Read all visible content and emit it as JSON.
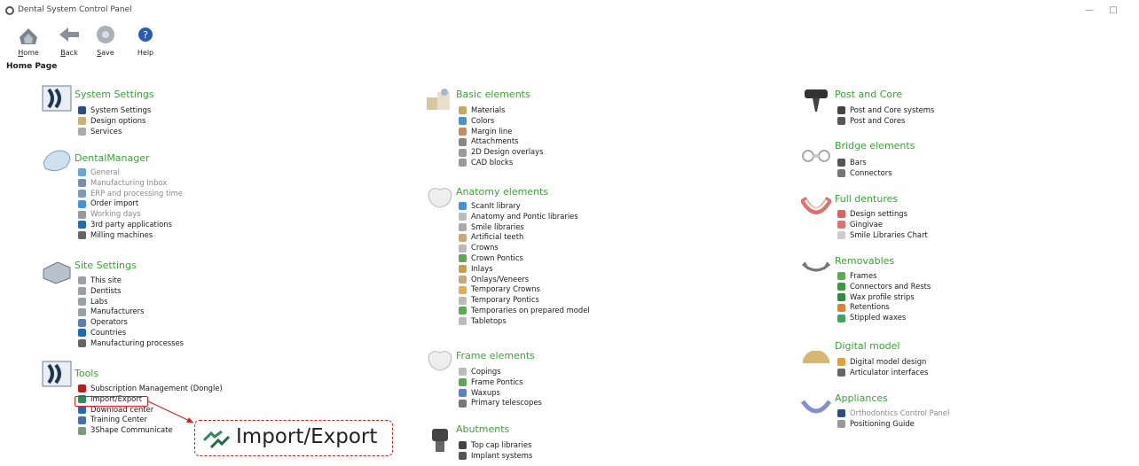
{
  "window": {
    "title": "Dental System Control Panel",
    "minimize": "—",
    "maximize": "□"
  },
  "toolbar": [
    {
      "key": "home",
      "label": "Home",
      "ul": "H",
      "rest": "ome",
      "icon": "home-icon"
    },
    {
      "key": "back",
      "label": "Back",
      "ul": "B",
      "rest": "ack",
      "icon": "back-arrow-icon"
    },
    {
      "key": "save",
      "label": "Save",
      "ul": "S",
      "rest": "ave",
      "icon": "save-icon"
    },
    {
      "key": "help",
      "label": "Help",
      "ul": "",
      "rest": "Help",
      "icon": "help-icon"
    }
  ],
  "page_title": "Home Page",
  "sections": [
    {
      "title": "System Settings",
      "icon": "system-settings-icon",
      "items": [
        {
          "label": "System Settings",
          "icon": "system-settings-small-icon",
          "color": "#2d4f7a"
        },
        {
          "label": "Design options",
          "icon": "design-options-icon",
          "color": "#c9b27a"
        },
        {
          "label": "Services",
          "icon": "gear-icon",
          "color": "#aaaaaa"
        }
      ]
    },
    {
      "title": "DentalManager",
      "icon": "dental-manager-icon",
      "items": [
        {
          "label": "General",
          "icon": "general-icon",
          "color": "#6aa3d5",
          "gray": true
        },
        {
          "label": "Manufacturing Inbox",
          "icon": "inbox-icon",
          "color": "#7c8fa8",
          "gray": true
        },
        {
          "label": "ERP and processing time",
          "icon": "erp-icon",
          "color": "#7a9ac2",
          "gray": true
        },
        {
          "label": "Order import",
          "icon": "order-import-icon",
          "color": "#4a90d9"
        },
        {
          "label": "Working days",
          "icon": "clock-icon",
          "color": "#999999",
          "gray": true
        },
        {
          "label": "3rd party applications",
          "icon": "globe-icon",
          "color": "#1c6bb5"
        },
        {
          "label": "Milling machines",
          "icon": "milling-icon",
          "color": "#666666"
        }
      ]
    },
    {
      "title": "Site Settings",
      "icon": "site-settings-icon",
      "items": [
        {
          "label": "This site",
          "icon": "site-icon",
          "color": "#9aa0a6"
        },
        {
          "label": "Dentists",
          "icon": "dentists-icon",
          "color": "#9aa0a6"
        },
        {
          "label": "Labs",
          "icon": "labs-icon",
          "color": "#9aa0a6"
        },
        {
          "label": "Manufacturers",
          "icon": "manufacturers-icon",
          "color": "#9aa0a6"
        },
        {
          "label": "Operators",
          "icon": "operators-icon",
          "color": "#5a7fb0"
        },
        {
          "label": "Countries",
          "icon": "globe-icon",
          "color": "#1c6bb5"
        },
        {
          "label": "Manufacturing processes",
          "icon": "process-icon",
          "color": "#666666"
        }
      ]
    },
    {
      "title": "Tools",
      "icon": "tools-icon",
      "items": [
        {
          "label": "Subscription Management (Dongle)",
          "icon": "dongle-icon",
          "color": "#b02020"
        },
        {
          "label": "Import/Export",
          "icon": "import-export-icon",
          "color": "#2e8b57"
        },
        {
          "label": "Download center",
          "icon": "globe-icon",
          "color": "#1c6bb5"
        },
        {
          "label": "Training Center",
          "icon": "training-icon",
          "color": "#4a6fa5"
        },
        {
          "label": "3Shape Communicate",
          "icon": "communicate-icon",
          "color": "#7a9a7a"
        }
      ]
    },
    {
      "title": "Basic elements",
      "icon": "basic-elements-icon",
      "items": [
        {
          "label": "Materials",
          "icon": "materials-icon",
          "color": "#c8a860"
        },
        {
          "label": "Colors",
          "icon": "colors-icon",
          "color": "#4a90d9"
        },
        {
          "label": "Margin line",
          "icon": "margin-line-icon",
          "color": "#c88a60"
        },
        {
          "label": "Attachments",
          "icon": "attachments-icon",
          "color": "#888888"
        },
        {
          "label": "2D Design overlays",
          "icon": "overlay-icon",
          "color": "#999999"
        },
        {
          "label": "CAD blocks",
          "icon": "cad-blocks-icon",
          "color": "#999999"
        }
      ]
    },
    {
      "title": "Anatomy elements",
      "icon": "anatomy-icon",
      "items": [
        {
          "label": "ScanIt library",
          "icon": "scanit-icon",
          "color": "#4a90d9"
        },
        {
          "label": "Anatomy and Pontic libraries",
          "icon": "tooth-icon",
          "color": "#bbbbbb"
        },
        {
          "label": "Smile libraries",
          "icon": "smile-icon",
          "color": "#aaaaaa"
        },
        {
          "label": "Artificial teeth",
          "icon": "artificial-teeth-icon",
          "color": "#c8a878"
        },
        {
          "label": "Crowns",
          "icon": "crown-icon",
          "color": "#bbbbbb"
        },
        {
          "label": "Crown Pontics",
          "icon": "crown-pontic-icon",
          "color": "#5aaa50"
        },
        {
          "label": "Inlays",
          "icon": "inlay-icon",
          "color": "#c8a040"
        },
        {
          "label": "Onlays/Veneers",
          "icon": "onlay-icon",
          "color": "#c8a878"
        },
        {
          "label": "Temporary Crowns",
          "icon": "temp-crown-icon",
          "color": "#e0b050"
        },
        {
          "label": "Temporary Pontics",
          "icon": "temp-pontic-icon",
          "color": "#bbbbbb"
        },
        {
          "label": "Temporaries on prepared model",
          "icon": "temp-model-icon",
          "color": "#5aaa50"
        },
        {
          "label": "Tabletops",
          "icon": "tabletop-icon",
          "color": "#bbbbbb"
        }
      ]
    },
    {
      "title": "Frame elements",
      "icon": "frame-elements-icon",
      "items": [
        {
          "label": "Copings",
          "icon": "coping-icon",
          "color": "#bbbbbb"
        },
        {
          "label": "Frame Pontics",
          "icon": "frame-pontic-icon",
          "color": "#5aaa50"
        },
        {
          "label": "Waxups",
          "icon": "waxup-icon",
          "color": "#5a7fd0"
        },
        {
          "label": "Primary telescopes",
          "icon": "telescope-icon",
          "color": "#777777"
        }
      ]
    },
    {
      "title": "Abutments",
      "icon": "abutments-icon",
      "items": [
        {
          "label": "Top cap libraries",
          "icon": "top-cap-icon",
          "color": "#444444"
        },
        {
          "label": "Implant systems",
          "icon": "implant-icon",
          "color": "#555555"
        }
      ]
    },
    {
      "title": "Post and Core",
      "icon": "post-core-icon",
      "items": [
        {
          "label": "Post and Core systems",
          "icon": "post-icon",
          "color": "#444444"
        },
        {
          "label": "Post and Cores",
          "icon": "core-icon",
          "color": "#555555"
        }
      ]
    },
    {
      "title": "Bridge elements",
      "icon": "bridge-elements-icon",
      "items": [
        {
          "label": "Bars",
          "icon": "bars-icon",
          "color": "#555555"
        },
        {
          "label": "Connectors",
          "icon": "connectors-icon",
          "color": "#777777"
        }
      ]
    },
    {
      "title": "Full dentures",
      "icon": "full-dentures-icon",
      "items": [
        {
          "label": "Design settings",
          "icon": "design-settings-icon",
          "color": "#e06060"
        },
        {
          "label": "Gingivae",
          "icon": "gingivae-icon",
          "color": "#e07070"
        },
        {
          "label": "Smile Libraries Chart",
          "icon": "chart-icon",
          "color": "#cccccc"
        }
      ]
    },
    {
      "title": "Removables",
      "icon": "removables-icon",
      "items": [
        {
          "label": "Frames",
          "icon": "frames-icon",
          "color": "#5aaa50"
        },
        {
          "label": "Connectors and Rests",
          "icon": "rests-icon",
          "color": "#3a9a40"
        },
        {
          "label": "Wax profile strips",
          "icon": "wax-strip-icon",
          "color": "#2e8b40"
        },
        {
          "label": "Retentions",
          "icon": "retention-icon",
          "color": "#e08030"
        },
        {
          "label": "Stippled waxes",
          "icon": "stippled-icon",
          "color": "#3aa860"
        }
      ]
    },
    {
      "title": "Digital model",
      "icon": "digital-model-icon",
      "items": [
        {
          "label": "Digital model design",
          "icon": "model-design-icon",
          "color": "#e0a040"
        },
        {
          "label": "Articulator interfaces",
          "icon": "articulator-icon",
          "color": "#666666"
        }
      ]
    },
    {
      "title": "Appliances",
      "icon": "appliances-icon",
      "items": [
        {
          "label": "Orthodontics Control Panel",
          "icon": "ortho-icon",
          "color": "#2d4f7a",
          "gray": true
        },
        {
          "label": "Positioning Guide",
          "icon": "positioning-icon",
          "color": "#999999"
        }
      ]
    }
  ],
  "callout": {
    "label": "Import/Export",
    "icon": "import-export-icon"
  }
}
